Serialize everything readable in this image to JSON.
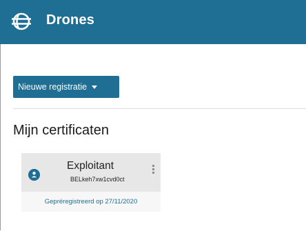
{
  "header": {
    "app_title": "Drones",
    "logo_icon": "globe-logo-icon",
    "brand_color": "#1f6e93"
  },
  "actions": {
    "new_registration_label": "Nieuwe registratie",
    "new_registration_icon": "caret-down-icon"
  },
  "section": {
    "title": "Mijn certificaten"
  },
  "certificates": [
    {
      "title": "Exploitant",
      "code": "BELkeh7xw1cvd0ct",
      "status": "Gepréregistreerd op 27/11/2020",
      "icon": "user-icon"
    }
  ]
}
